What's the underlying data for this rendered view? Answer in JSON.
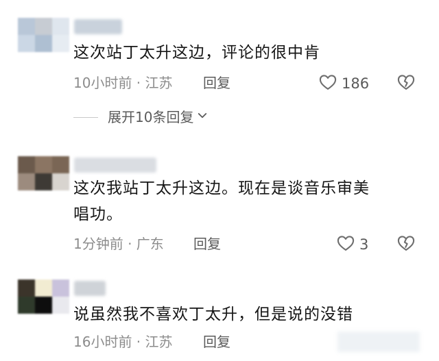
{
  "comments": [
    {
      "text": "这次站丁太升这边，评论的很中肯",
      "time_location": "10小时前 · 江苏",
      "reply_label": "回复",
      "like_count": "186",
      "replies_expand_label": "展开10条回复"
    },
    {
      "text_line1": "这次我站丁太升这边。现在是谈音乐审美",
      "text_line2": "唱功。",
      "time_location": "1分钟前 · 广东",
      "reply_label": "回复",
      "like_count": "3"
    },
    {
      "text": "说虽然我不喜欢丁太升，但是说的没错",
      "time_location": "16小时前 · 江苏",
      "reply_label": "回复"
    }
  ],
  "icons": {
    "like": "heart-outline-icon",
    "dislike": "broken-heart-icon",
    "expand": "chevron-down-icon"
  },
  "colors": {
    "text_primary": "#161616",
    "text_secondary": "#8c8c8c",
    "action_text": "#5a5a5a",
    "icon_stroke": "#6e6e6e"
  }
}
